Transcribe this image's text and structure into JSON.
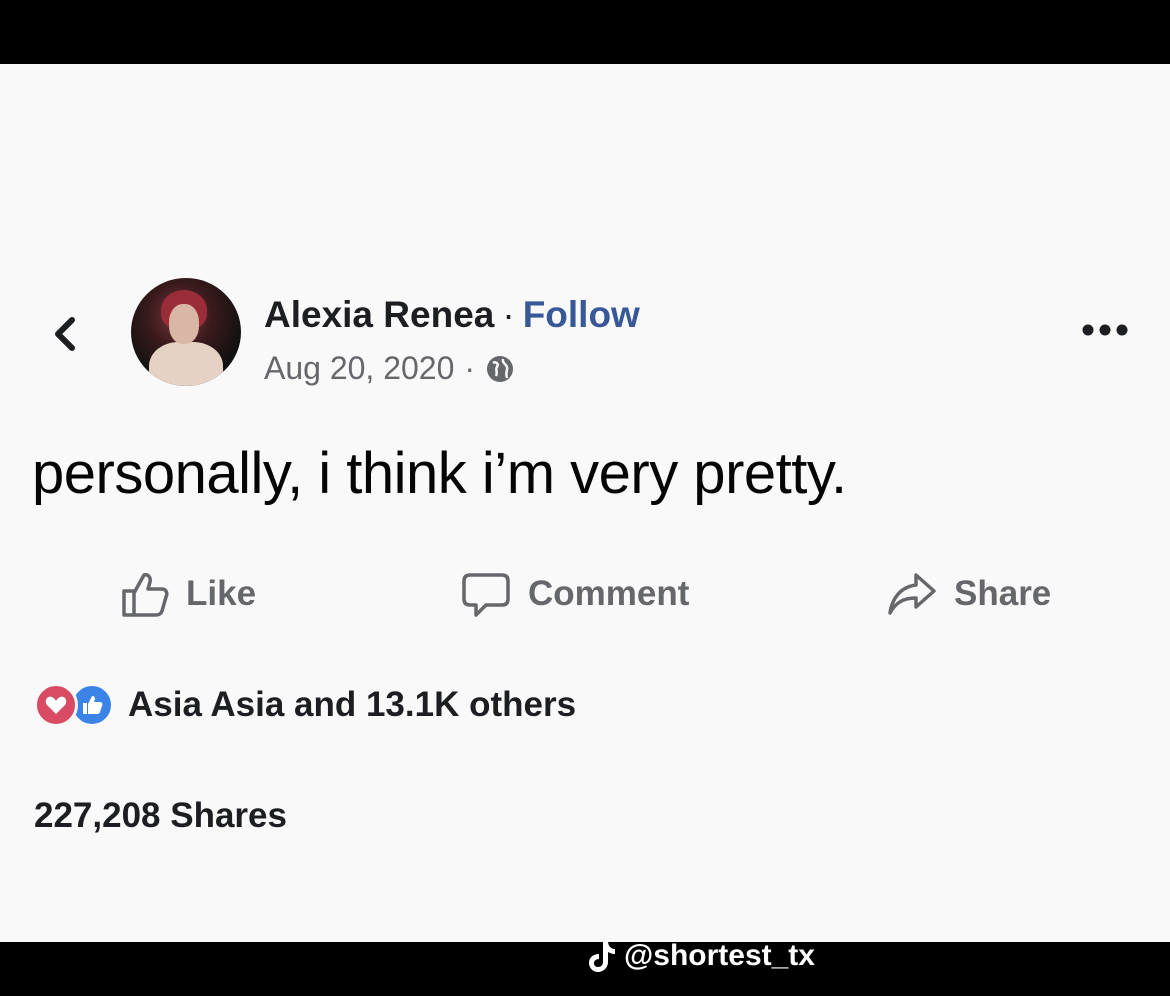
{
  "post": {
    "author_name": "Alexia Renea",
    "separator": "·",
    "follow_label": "Follow",
    "date": "Aug 20, 2020",
    "date_separator": "·",
    "text": "personally, i think i’m very pretty."
  },
  "actions": {
    "like_label": "Like",
    "comment_label": "Comment",
    "share_label": "Share"
  },
  "reactions": {
    "summary": "Asia Asia and 13.1K others"
  },
  "shares": {
    "count_label": "227,208 Shares"
  },
  "watermark": {
    "handle": "@shortest_tx"
  },
  "icons": {
    "back": "chevron-left-icon",
    "privacy": "globe-icon",
    "more": "more-dots-icon",
    "like": "thumbs-up-icon",
    "comment": "comment-bubble-icon",
    "share": "share-arrow-icon",
    "heart": "heart-reaction-icon",
    "like_reaction": "like-reaction-icon",
    "tiktok": "tiktok-logo-icon"
  },
  "colors": {
    "follow_link": "#385898",
    "secondary_text": "#65676b",
    "heart_reaction": "#d94b63",
    "like_reaction": "#3b83e6"
  }
}
